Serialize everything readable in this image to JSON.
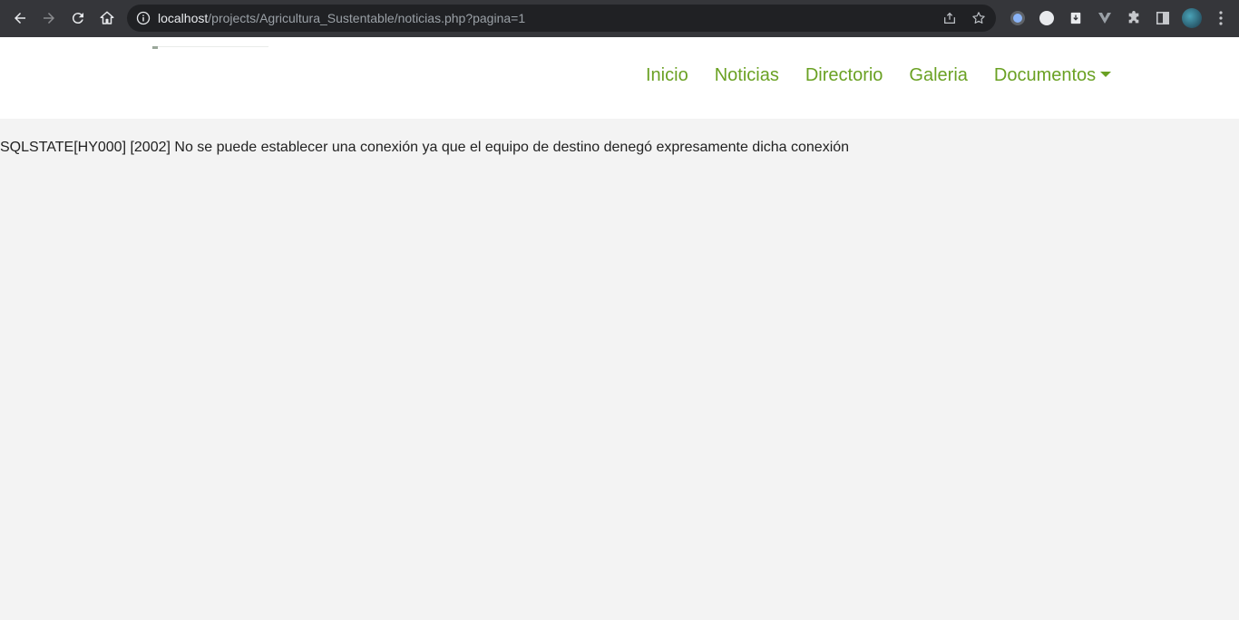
{
  "browser": {
    "url_host": "localhost",
    "url_path": "/projects/Agricultura_Sustentable/noticias.php?pagina=1"
  },
  "nav": {
    "items": [
      "Inicio",
      "Noticias",
      "Directorio",
      "Galeria",
      "Documentos"
    ]
  },
  "content": {
    "error_message": "SQLSTATE[HY000] [2002] No se puede establecer una conexión ya que el equipo de destino denegó expresamente dicha conexión"
  },
  "colors": {
    "nav_link": "#6aa123",
    "page_bg": "#f3f3f3",
    "chrome_bg": "#35363a"
  }
}
